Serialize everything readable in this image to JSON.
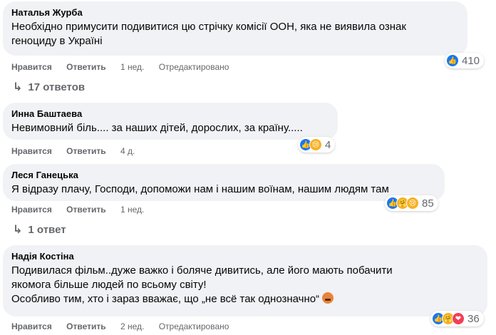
{
  "comments": [
    {
      "author": "Наталья Журба",
      "lines": [
        "Необхідно примусити подивитися цю стрічку комісії ООН, яка не виявила ознак",
        "геноциду в Україні"
      ],
      "like": "Нравится",
      "reply": "Ответить",
      "time": "1 нед.",
      "edited": "Отредактировано",
      "reaction_count": "410",
      "reactions": [
        "like-icon"
      ],
      "replies": "17 ответов"
    },
    {
      "author": "Инна Баштаева",
      "lines": [
        "Невимовний біль.... за наших дітей, дорослих, за країну....."
      ],
      "like": "Нравится",
      "reply": "Ответить",
      "time": "4 д.",
      "reaction_count": "4",
      "reactions": [
        "like-icon",
        "sad-icon"
      ]
    },
    {
      "author": "Леся Ганецька",
      "lines": [
        "Я відразу плачу, Господи, допоможи нам і нашим воїнам, нашим людям там"
      ],
      "like": "Нравится",
      "reply": "Ответить",
      "time": "1 нед.",
      "reaction_count": "85",
      "reactions": [
        "like-icon",
        "care-icon",
        "sad-icon"
      ],
      "replies": "1 ответ"
    },
    {
      "author": "Надія Костіна",
      "lines": [
        "Подивилася фільм..дуже важко і боляче дивитись, але його мають побачити",
        "якомога більше людей по всьому світу!",
        "Особливо тим, хто і зараз вважає, що „не всё так однозначно“"
      ],
      "like": "Нравится",
      "reply": "Ответить",
      "time": "2 нед.",
      "edited": "Отредактировано",
      "reaction_count": "36",
      "reactions": [
        "like-icon",
        "care-icon",
        "love-icon"
      ],
      "inline_emoji": "angry-face-icon"
    }
  ]
}
